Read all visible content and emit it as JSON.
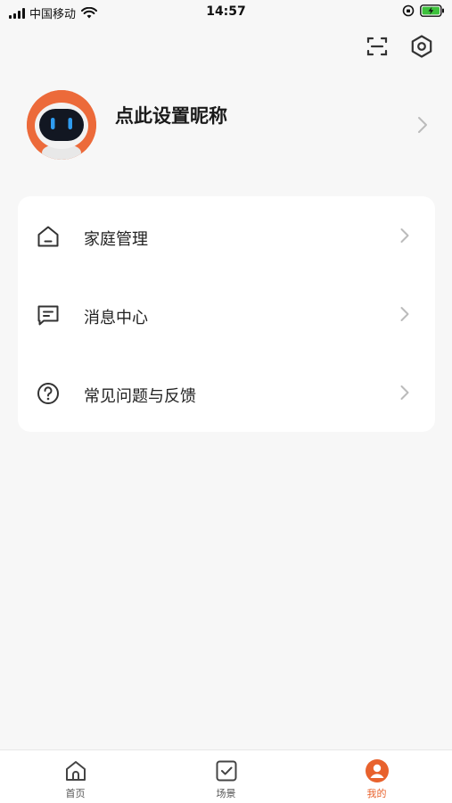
{
  "status_bar": {
    "carrier": "中国移动",
    "time": "14:57"
  },
  "top_actions": {
    "scan_icon": "scan-icon",
    "settings_icon": "hexagon-settings-icon"
  },
  "profile": {
    "nickname": "点此设置昵称",
    "avatar_icon": "robot-avatar"
  },
  "menu": {
    "items": [
      {
        "label": "家庭管理",
        "icon": "home-icon"
      },
      {
        "label": "消息中心",
        "icon": "message-icon"
      },
      {
        "label": "常见问题与反馈",
        "icon": "question-icon"
      }
    ]
  },
  "tabs": [
    {
      "label": "首页",
      "icon": "home-icon",
      "active": false
    },
    {
      "label": "场景",
      "icon": "checkbox-icon",
      "active": false
    },
    {
      "label": "我的",
      "icon": "user-icon",
      "active": true
    }
  ],
  "colors": {
    "accent": "#e8622d",
    "background": "#f7f7f7",
    "card": "#ffffff"
  }
}
